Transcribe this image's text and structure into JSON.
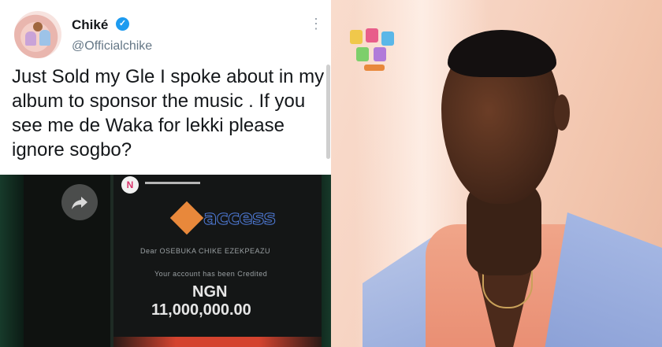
{
  "tweet": {
    "display_name": "Chiké",
    "handle": "@Officialchike",
    "text": "Just Sold my Gle I spoke about in my album to sponsor the music . If you see me de Waka for lekki please ignore sogbo?"
  },
  "bank_alert": {
    "sender_initial": "N",
    "bank_logo_text": "access",
    "greeting": "Dear OSEBUKA CHIKE EZEKPEAZU",
    "status_text": "Your account has been Credited",
    "currency": "NGN",
    "amount": "11,000,000.00"
  },
  "colors": {
    "verified": "#1d9bf0",
    "access_orange": "#e8883b",
    "access_blue": "#4f7bd8",
    "jacket": "#a9bbe6",
    "shirt": "#f0a589"
  }
}
